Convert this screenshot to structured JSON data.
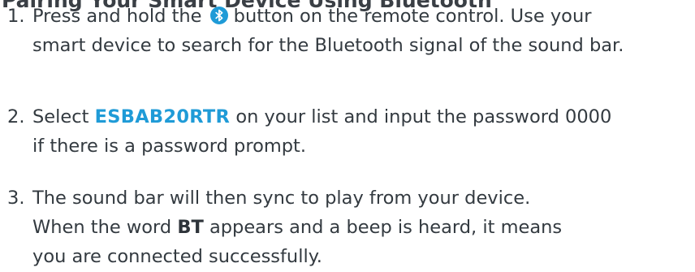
{
  "heading": "Pairing Your Smart Device Using Bluetooth",
  "steps": [
    {
      "number": "1.",
      "line1_before": "Press and hold the",
      "icon": "bluetooth-icon",
      "line1_after": "button on the remote control. Use your",
      "line2": "smart device to search for the Bluetooth signal of the sound bar."
    },
    {
      "number": "2.",
      "line1_before": "Select",
      "device_name": "ESBAB20RTR",
      "line1_after": "on your list and input the password 0000",
      "line2": "if there is a password prompt."
    },
    {
      "number": "3.",
      "line1": "The sound bar will then sync to play from your device.",
      "line2_before": "When the word",
      "indicator": "BT",
      "line2_after": "appears and a beep is heard, it means",
      "line3": "you are connected successfully."
    }
  ],
  "colors": {
    "text": "#333a40",
    "accent": "#1f9bd7"
  }
}
